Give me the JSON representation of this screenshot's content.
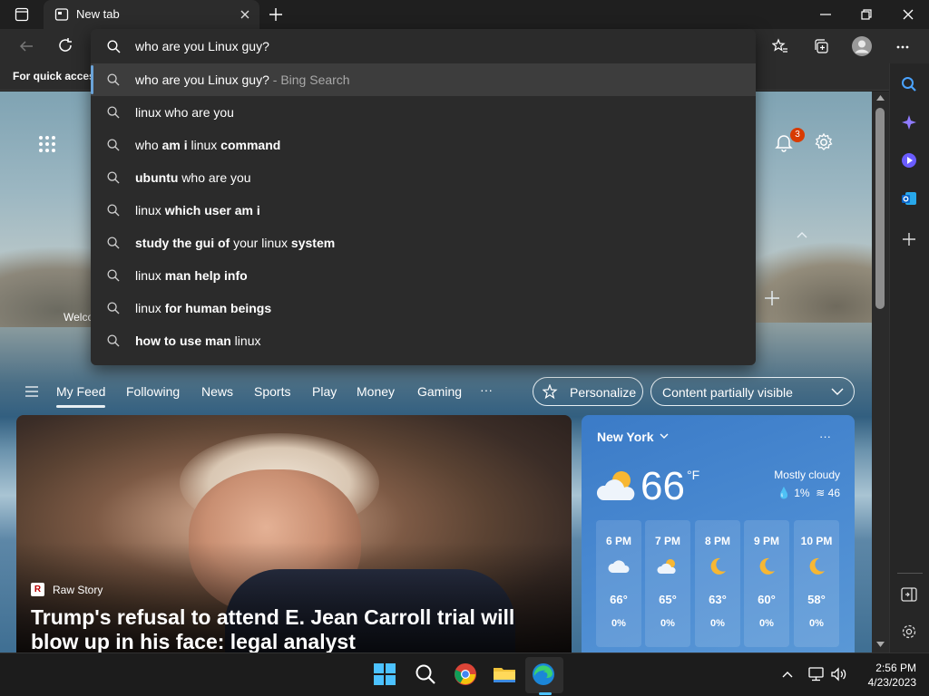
{
  "browser": {
    "tab_title": "New tab",
    "favorites_bar_text": "For quick access, place your favorites here on the favorites bar."
  },
  "omnibox": {
    "query": "who are you Linux guy?",
    "suggestions": [
      {
        "parts": [
          {
            "text": "who are you Linux guy?",
            "bold": false
          }
        ],
        "hint": " - Bing Search",
        "selected": true
      },
      {
        "parts": [
          {
            "text": "linux who are you",
            "bold": false
          }
        ]
      },
      {
        "parts": [
          {
            "text": "who ",
            "bold": false
          },
          {
            "text": "am i",
            "bold": true
          },
          {
            "text": " linux ",
            "bold": false
          },
          {
            "text": "command",
            "bold": true
          }
        ]
      },
      {
        "parts": [
          {
            "text": "ubuntu",
            "bold": true
          },
          {
            "text": " who are you",
            "bold": false
          }
        ]
      },
      {
        "parts": [
          {
            "text": "linux ",
            "bold": false
          },
          {
            "text": "which user am i",
            "bold": true
          }
        ]
      },
      {
        "parts": [
          {
            "text": "study the gui of",
            "bold": true
          },
          {
            "text": " your ",
            "bold": false
          },
          {
            "text": "linux",
            "bold": false
          },
          {
            "text": " system",
            "bold": true
          }
        ]
      },
      {
        "parts": [
          {
            "text": "linux ",
            "bold": false
          },
          {
            "text": "man help info",
            "bold": true
          }
        ]
      },
      {
        "parts": [
          {
            "text": "linux ",
            "bold": false
          },
          {
            "text": "for human beings",
            "bold": true
          }
        ]
      },
      {
        "parts": [
          {
            "text": "how to use man",
            "bold": true
          },
          {
            "text": " linux",
            "bold": false
          }
        ]
      }
    ]
  },
  "newtab": {
    "notification_count": "3",
    "welcome_partial": "Welco"
  },
  "feed_nav": {
    "items": [
      "My Feed",
      "Following",
      "News",
      "Sports",
      "Play",
      "Money",
      "Gaming"
    ],
    "more": "···",
    "personalize": "Personalize",
    "content_visibility": "Content partially visible"
  },
  "news": {
    "source": "Raw Story",
    "headline": "Trump's refusal to attend E. Jean Carroll trial will blow up in his face: legal analyst"
  },
  "weather": {
    "city": "New York",
    "temperature": "66",
    "unit": "°F",
    "condition": "Mostly cloudy",
    "precip": "1%",
    "wind": "46",
    "hourly": [
      {
        "time": "6 PM",
        "temp": "66°",
        "precip": "0%",
        "icon": "cloud-icon"
      },
      {
        "time": "7 PM",
        "temp": "65°",
        "precip": "0%",
        "icon": "partly-cloudy-icon"
      },
      {
        "time": "8 PM",
        "temp": "63°",
        "precip": "0%",
        "icon": "moon-icon"
      },
      {
        "time": "9 PM",
        "temp": "60°",
        "precip": "0%",
        "icon": "moon-icon"
      },
      {
        "time": "10 PM",
        "temp": "58°",
        "precip": "0%",
        "icon": "moon-icon"
      }
    ]
  },
  "taskbar": {
    "time": "2:56 PM",
    "date": "4/23/2023"
  },
  "colors": {
    "accent": "#6aa3d8",
    "badge": "#d83b01",
    "weather_card": "#4b8bd2"
  }
}
